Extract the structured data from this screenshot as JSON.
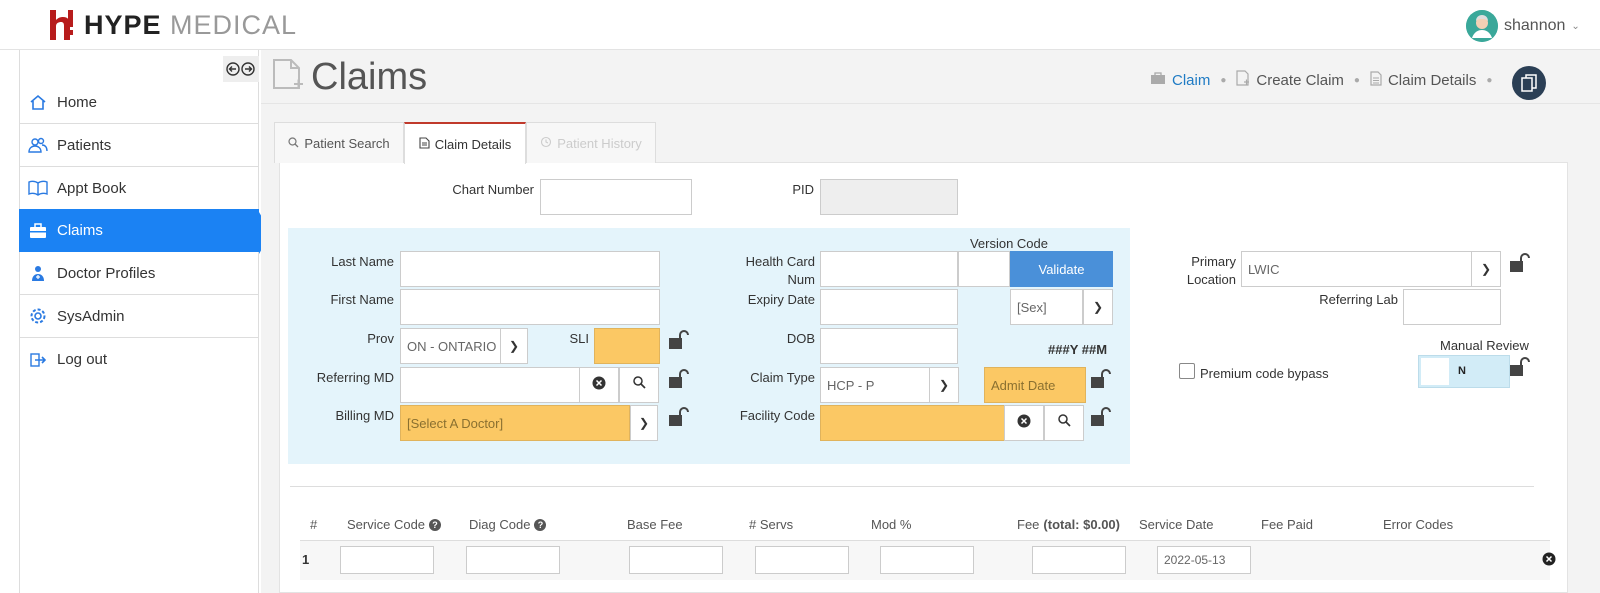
{
  "brand": {
    "name_bold": "HYPE",
    "name_light": "MEDICAL",
    "mark": "h!"
  },
  "user": {
    "name": "shannon"
  },
  "sidebar": {
    "items": [
      {
        "label": "Home",
        "icon": "home-icon"
      },
      {
        "label": "Patients",
        "icon": "users-icon"
      },
      {
        "label": "Appt Book",
        "icon": "book-icon"
      },
      {
        "label": "Claims",
        "icon": "briefcase-icon",
        "active": true
      },
      {
        "label": "Doctor Profiles",
        "icon": "doctor-icon"
      },
      {
        "label": "SysAdmin",
        "icon": "gear-icon"
      },
      {
        "label": "Log out",
        "icon": "logout-icon"
      }
    ]
  },
  "page": {
    "title": "Claims"
  },
  "breadcrumb": {
    "items": [
      "Claim",
      "Create Claim",
      "Claim Details"
    ]
  },
  "tabs": [
    {
      "label": "Patient Search",
      "icon": "search-icon"
    },
    {
      "label": "Claim Details",
      "icon": "document-icon",
      "active": true
    },
    {
      "label": "Patient History",
      "icon": "history-icon",
      "disabled": true
    }
  ],
  "form": {
    "chart_number_label": "Chart Number",
    "pid_label": "PID",
    "last_name_label": "Last Name",
    "first_name_label": "First Name",
    "prov_label": "Prov",
    "prov_value": "ON - ONTARIO",
    "sli_label": "SLI",
    "referring_md_label": "Referring MD",
    "billing_md_label": "Billing MD",
    "billing_md_value": "[Select A Doctor]",
    "version_code_label": "Version Code",
    "health_card_label_1": "Health Card",
    "health_card_label_2": "Num",
    "validate_label": "Validate",
    "expiry_date_label": "Expiry Date",
    "sex_value": "[Sex]",
    "dob_label": "DOB",
    "dob_hint": "###Y ##M",
    "claim_type_label": "Claim Type",
    "claim_type_value": "HCP - P",
    "admit_date_placeholder": "Admit Date",
    "facility_code_label": "Facility Code",
    "primary_location_label_1": "Primary",
    "primary_location_label_2": "Location",
    "primary_location_value": "LWIC",
    "referring_lab_label": "Referring Lab",
    "manual_review_label": "Manual Review",
    "manual_review_value": "N",
    "premium_bypass_label": "Premium code bypass"
  },
  "table": {
    "headers": {
      "num": "#",
      "service_code": "Service Code",
      "diag_code": "Diag Code",
      "base_fee": "Base Fee",
      "servs": "# Servs",
      "mod": "Mod %",
      "fee": "Fee",
      "fee_total": "(total: $0.00)",
      "service_date": "Service Date",
      "fee_paid": "Fee Paid",
      "error_codes": "Error Codes"
    },
    "rows": [
      {
        "num": "1",
        "service_date": "2022-05-13"
      }
    ]
  },
  "colors": {
    "accent": "#1b82f3",
    "required": "#fbc864",
    "validate": "#4a90d9",
    "panel_blue": "#e4f4fb"
  }
}
